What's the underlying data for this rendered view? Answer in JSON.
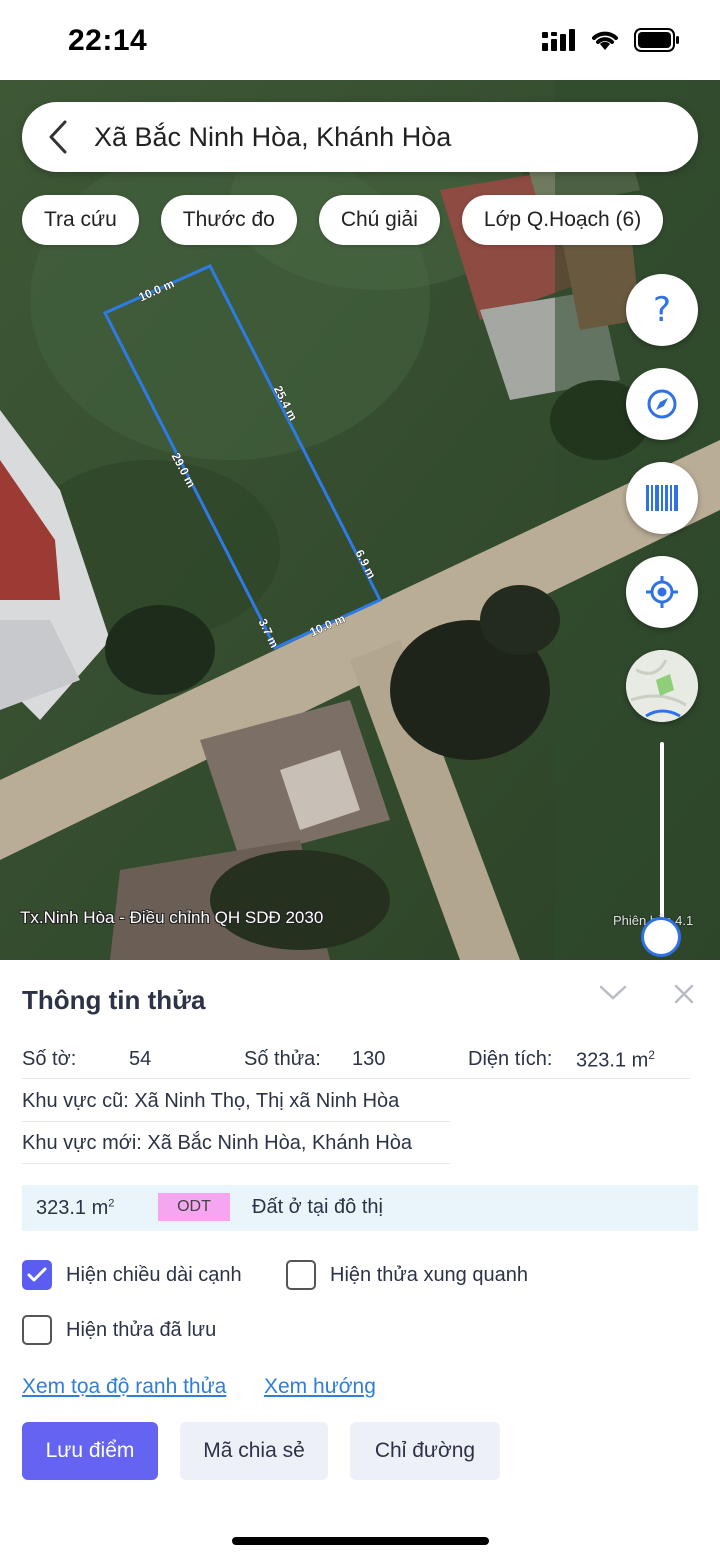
{
  "status_bar": {
    "time": "22:14"
  },
  "search": {
    "location": "Xã Bắc Ninh Hòa, Khánh Hòa"
  },
  "chips": [
    {
      "label": "Tra cứu"
    },
    {
      "label": "Thước đo"
    },
    {
      "label": "Chú giải"
    },
    {
      "label": "Lớp Q.Hoạch (6)"
    }
  ],
  "map": {
    "edge_labels": [
      "10.0 m",
      "25.4 m",
      "29.0 m",
      "6.9 m",
      "3.7 m",
      "10.0 m"
    ],
    "layer_label": "Tx.Ninh Hòa - Điều chỉnh QH SDĐ 2030",
    "zoom_label": "Phiên bản 4.1",
    "zoom_level": 0.05,
    "parcel_outline_color": "#2f7be6",
    "controls": [
      {
        "icon": "help-icon",
        "glyph": "?"
      },
      {
        "icon": "compass-icon"
      },
      {
        "icon": "barcode-icon"
      },
      {
        "icon": "locate-icon"
      },
      {
        "icon": "minimap-icon"
      }
    ]
  },
  "panel": {
    "title": "Thông tin thửa",
    "so_to_label": "Số tờ:",
    "so_to_value": "54",
    "so_thua_label": "Số thửa:",
    "so_thua_value": "130",
    "dien_tich_label": "Diện tích:",
    "dien_tich_value": "323.1 m",
    "dien_tich_unit_sup": "2",
    "khu_vuc_cu": "Khu vực cũ: Xã Ninh Thọ, Thị xã Ninh Hòa",
    "khu_vuc_moi": "Khu vực mới: Xã Bắc Ninh Hòa, Khánh Hòa",
    "land_area": "323.1 m",
    "land_area_sup": "2",
    "land_code": "ODT",
    "land_code_color": "#f6a6f1",
    "land_type": "Đất ở tại đô thị",
    "checkboxes": [
      {
        "label": "Hiện chiều dài cạnh",
        "checked": true
      },
      {
        "label": "Hiện thửa xung quanh",
        "checked": false
      },
      {
        "label": "Hiện thửa đã lưu",
        "checked": false
      }
    ],
    "links": [
      "Xem tọa độ ranh thửa",
      "Xem hướng"
    ],
    "buttons": [
      {
        "label": "Lưu điểm",
        "style": "primary"
      },
      {
        "label": "Mã chia sẻ",
        "style": "secondary"
      },
      {
        "label": "Chỉ đường",
        "style": "secondary"
      }
    ],
    "accent_color": "#6463f2",
    "link_color": "#2f7fd8"
  }
}
